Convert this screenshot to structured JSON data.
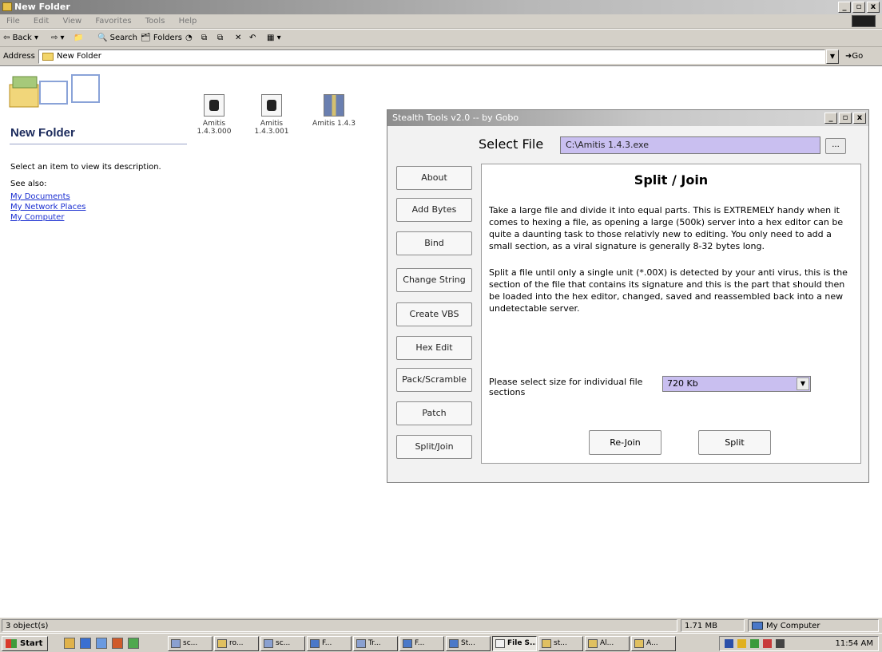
{
  "window": {
    "title": "New Folder",
    "controls": [
      "_",
      "▫",
      "x"
    ]
  },
  "menu": [
    "File",
    "Edit",
    "View",
    "Favorites",
    "Tools",
    "Help"
  ],
  "toolbar": {
    "back": "Back",
    "search": "Search",
    "folders": "Folders"
  },
  "address": {
    "label": "Address",
    "value": "New Folder",
    "go": "Go"
  },
  "left_pane": {
    "folder_title": "New Folder",
    "description": "Select an item to view its description.",
    "see_also": "See also:",
    "links": [
      "My Documents",
      "My Network Places",
      "My Computer"
    ]
  },
  "files": [
    {
      "name_line1": "Amitis",
      "name_line2": "1.4.3.000",
      "icon": "exe-icon"
    },
    {
      "name_line1": "Amitis",
      "name_line2": "1.4.3.001",
      "icon": "exe-icon"
    },
    {
      "name_line1": "Amitis 1.4.3",
      "name_line2": "",
      "icon": "archive-icon"
    }
  ],
  "dialog": {
    "title": "Stealth Tools v2.0 -- by Gobo",
    "controls": [
      "_",
      "▫",
      "x"
    ],
    "select_file_label": "Select File",
    "file_path": "C:\\Amitis 1.4.3.exe",
    "browse": "...",
    "nav": [
      "About",
      "Add Bytes",
      "Bind",
      "Change String",
      "Create VBS",
      "Hex Edit",
      "Pack/Scramble",
      "Patch",
      "Split/Join"
    ],
    "panel": {
      "title": "Split / Join",
      "paragraph1": "Take a large file and divide it into equal parts. This is EXTREMELY handy when it comes to hexing a file, as opening a large (500k) server into a hex editor can be quite a daunting task to those relativly new to editing. You only need to add a small section, as a viral signature is generally 8-32 bytes long.",
      "paragraph2": "Split a file until only a single unit (*.00X) is detected by your anti virus, this is the section of the file that contains its signature and this is the part that should then be loaded into the hex editor, changed, saved and reassembled back into a new undetectable server.",
      "size_label": "Please select size for individual file sections",
      "size_value": "720 Kb",
      "rejoin": "Re-Join",
      "split": "Split"
    }
  },
  "status": {
    "objects": "3 object(s)",
    "size": "1.71 MB",
    "location": "My Computer"
  },
  "taskbar": {
    "start": "Start",
    "tasks": [
      "sc...",
      "ro...",
      "sc...",
      "F...",
      "Tr...",
      "F...",
      "St...",
      "File S...",
      "st...",
      "Al...",
      "A..."
    ],
    "active_task": "File S...",
    "clock": "11:54 AM"
  }
}
